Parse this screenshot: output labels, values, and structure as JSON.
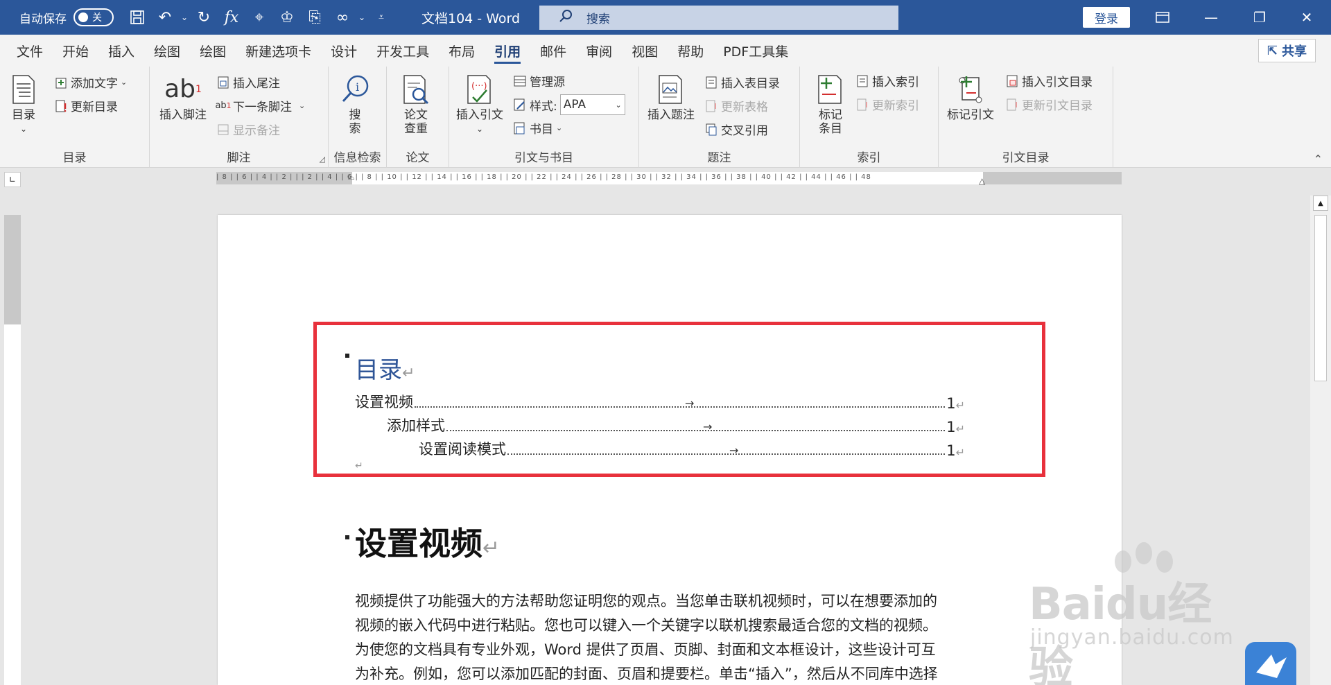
{
  "titlebar": {
    "autosave_label": "自动保存",
    "autosave_state": "关",
    "doc_title": "文档104  -  Word",
    "search_placeholder": "搜索",
    "login": "登录"
  },
  "menu": {
    "tabs": [
      "文件",
      "开始",
      "插入",
      "绘图",
      "绘图",
      "新建选项卡",
      "设计",
      "开发工具",
      "布局",
      "引用",
      "邮件",
      "审阅",
      "视图",
      "帮助",
      "PDF工具集"
    ],
    "active": "引用",
    "share": "共享"
  },
  "ribbon": {
    "toc": {
      "label": "目录",
      "btn": "目录",
      "add_text": "添加文字",
      "update_toc": "更新目录"
    },
    "footnote": {
      "label": "脚注",
      "insert_footnote": "插入脚注",
      "insert_endnote": "插入尾注",
      "next_footnote": "下一条脚注",
      "show_notes": "显示备注"
    },
    "research": {
      "label": "信息检索",
      "search_line1": "搜",
      "search_line2": "索"
    },
    "thesis": {
      "label": "论文",
      "btn_line1": "论文",
      "btn_line2": "查重"
    },
    "citations": {
      "label": "引文与书目",
      "insert_citation": "插入引文",
      "manage_sources": "管理源",
      "style_label": "样式:",
      "style_value": "APA",
      "bibliography": "书目"
    },
    "captions": {
      "label": "题注",
      "insert_caption": "插入题注",
      "insert_table_of_figures": "插入表目录",
      "update_table": "更新表格",
      "cross_reference": "交叉引用"
    },
    "index": {
      "label": "索引",
      "mark_entry_line1": "标记",
      "mark_entry_line2": "条目",
      "insert_index": "插入索引",
      "update_index": "更新索引"
    },
    "toa": {
      "label": "引文目录",
      "mark_citation": "标记引文",
      "insert_toa": "插入引文目录",
      "update_toa": "更新引文目录"
    }
  },
  "ruler": {
    "numbers": "| 8 |  | 6 |  | 4 |  | 2 |  |     | 2 |  | 4 |  | 6 |  | 8 |  | 10 |  | 12 |  | 14 |  | 16 |  | 18 |  | 20 |  | 22 |  | 24 |  | 26 |  | 28 |  | 30 |  | 32 |  | 34 |  | 36 |  | 38 |  | 40 |  | 42 |  | 44 |  | 46 |  | 48"
  },
  "document": {
    "toc_heading": "目录",
    "toc_entries": [
      {
        "text": "设置视频",
        "page": "1"
      },
      {
        "text": "添加样式",
        "page": "1"
      },
      {
        "text": "设置阅读模式",
        "page": "1"
      }
    ],
    "h1": "设置视频",
    "paragraph_lines": [
      "视频提供了功能强大的方法帮助您证明您的观点。当您单击联机视频时，可以在想要添加的",
      "视频的嵌入代码中进行粘贴。您也可以键入一个关键字以联机搜索最适合您的文档的视频。",
      "为使您的文档具有专业外观，Word 提供了页眉、页脚、封面和文本框设计，这些设计可互",
      "为补充。例如，您可以添加匹配的封面、页眉和提要栏。单击“插入”，然后从不同库中选择"
    ]
  },
  "watermark": {
    "brand": "Baidu经验",
    "url": "jingyan.baidu.com"
  },
  "colors": {
    "title_bar": "#2b579a",
    "accent": "#2f5597",
    "highlight_box": "#e8313c"
  }
}
